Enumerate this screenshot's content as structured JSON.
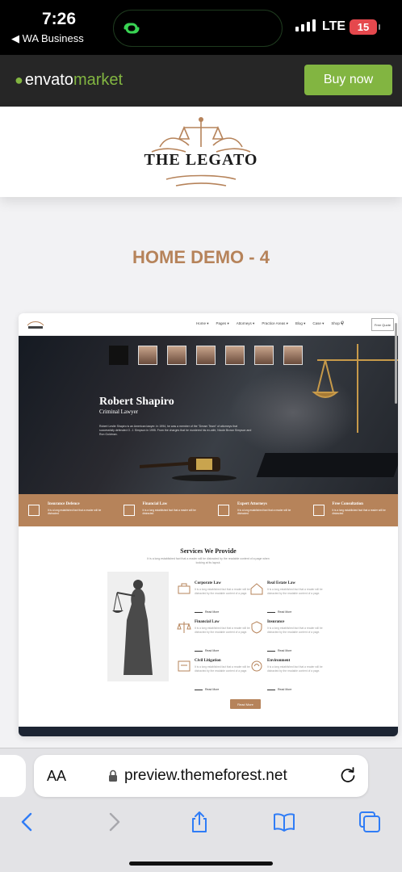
{
  "status_bar": {
    "time": "7:26",
    "back_label": "◀ WA Business",
    "network": "LTE",
    "battery": "15"
  },
  "envato": {
    "logo_primary": "envato",
    "logo_secondary": "market",
    "buy_label": "Buy now"
  },
  "brand": {
    "name": "THE LEGATO"
  },
  "demo_title": "HOME DEMO - 4",
  "preview": {
    "nav_items": [
      "Home ▾",
      "Pages ▾",
      "Attorneys ▾",
      "Practice Areas ▾",
      "Blog ▾",
      "Case ▾",
      "Shop ▾"
    ],
    "nav_button": "Free Quote",
    "hero_name": "Robert Shapiro",
    "hero_role": "Criminal Lawyer",
    "hero_desc": "Robert Leslie Shapiro is an American lawyer. In 1994, he was a member of the \"Dream Team\" of attorneys that successfully defended O. J. Simpson in 1995. From the charges that he murdered his ex-wife, Nicole Brown Simpson and Ron Goldman.",
    "features": [
      {
        "title": "Insurance Defence",
        "desc": "It is a long established fact that a reader will be distracted"
      },
      {
        "title": "Financial Law",
        "desc": "It is a long established fact that a reader will be distracted"
      },
      {
        "title": "Expert Attorneys",
        "desc": "It is a long established fact that a reader will be distracted"
      },
      {
        "title": "Free Consultation",
        "desc": "It is a long established fact that a reader will be distracted"
      }
    ],
    "services_title": "Services We Provide",
    "services_sub": "It is a long established fact that a reader will be distracted by the readable content of a page when looking at its layout.",
    "services": [
      {
        "title": "Corporate Law",
        "desc": "It is a long established fact that a reader will be distracted by the readable content of a page.",
        "link": "Read More"
      },
      {
        "title": "Real Estate Law",
        "desc": "It is a long established fact that a reader will be distracted by the readable content of a page.",
        "link": "Read More"
      },
      {
        "title": "Financial Law",
        "desc": "It is a long established fact that a reader will be distracted by the readable content of a page.",
        "link": "Read More"
      },
      {
        "title": "Insurance",
        "desc": "It is a long established fact that a reader will be distracted by the readable content of a page.",
        "link": "Read More"
      },
      {
        "title": "Civil Litigation",
        "desc": "It is a long established fact that a reader will be distracted by the readable content of a page.",
        "link": "Read More"
      },
      {
        "title": "Environment",
        "desc": "It is a long established fact that a reader will be distracted by the readable content of a page.",
        "link": "Read More"
      }
    ],
    "read_more_button": "Read More"
  },
  "safari": {
    "text_size_label": "AA",
    "url": "preview.themeforest.net"
  },
  "colors": {
    "accent_gold": "#b6835a",
    "envato_green": "#82b541",
    "dark_bar": "#262626"
  }
}
